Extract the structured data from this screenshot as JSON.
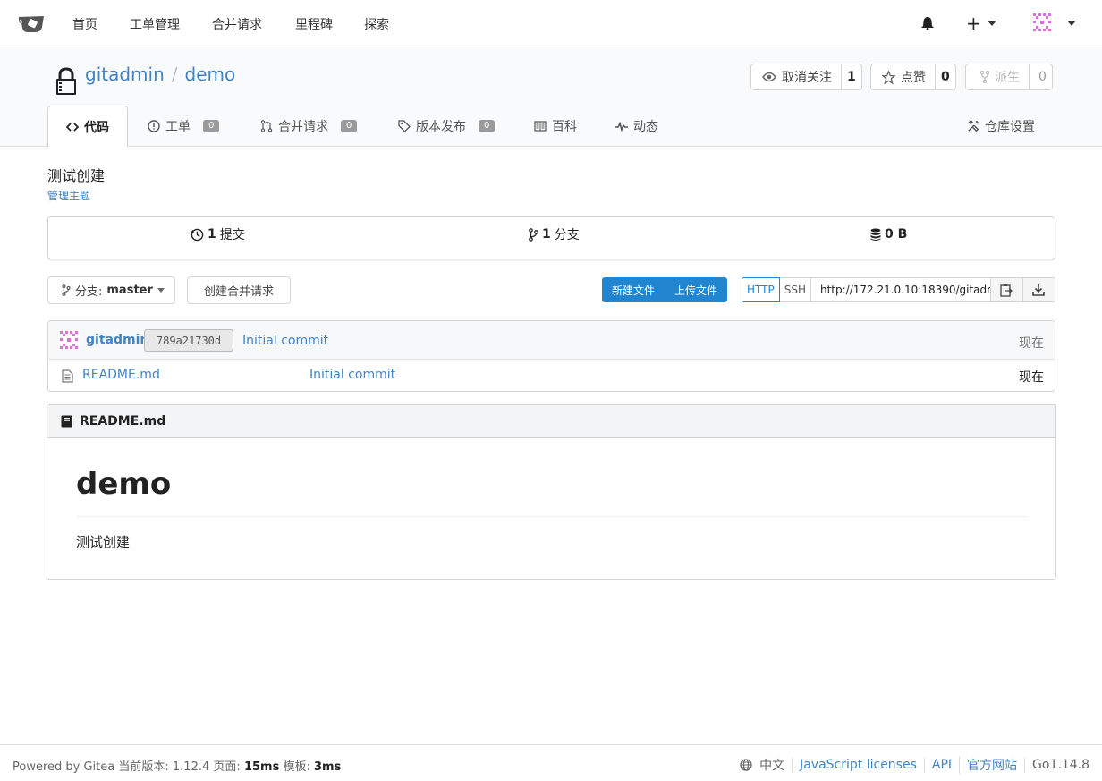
{
  "nav": {
    "items": [
      "首页",
      "工单管理",
      "合并请求",
      "里程碑",
      "探索"
    ]
  },
  "repo": {
    "owner": "gitadmin",
    "separator": "/",
    "name": "demo",
    "watch": {
      "label": "取消关注",
      "count": "1"
    },
    "star": {
      "label": "点赞",
      "count": "0"
    },
    "fork": {
      "label": "派生",
      "count": "0"
    }
  },
  "tabs": [
    {
      "label": "代码"
    },
    {
      "label": "工单",
      "badge": "0"
    },
    {
      "label": "合并请求",
      "badge": "0"
    },
    {
      "label": "版本发布",
      "badge": "0"
    },
    {
      "label": "百科"
    },
    {
      "label": "动态"
    }
  ],
  "settings_label": "仓库设置",
  "description": "测试创建",
  "manage_topics": "管理主题",
  "stats": {
    "commits_num": "1",
    "commits_label": "提交",
    "branches_num": "1",
    "branches_label": "分支",
    "size": "0 B"
  },
  "branch": {
    "label": "分支:",
    "name": "master"
  },
  "create_pr": "创建合并请求",
  "file_buttons": {
    "new_file": "新建文件",
    "upload_file": "上传文件"
  },
  "clone": {
    "http": "HTTP",
    "ssh": "SSH",
    "url": "http://172.21.0.10:18390/gitadmi"
  },
  "latest_commit": {
    "author": "gitadmin",
    "sha": "789a21730d",
    "message": "Initial commit",
    "time": "现在"
  },
  "files": [
    {
      "name": "README.md",
      "message": "Initial commit",
      "time": "现在"
    }
  ],
  "readme": {
    "title": "README.md",
    "h1": "demo",
    "body": "测试创建"
  },
  "footer": {
    "powered": "Powered by Gitea",
    "version_label": "当前版本:",
    "version": "1.12.4",
    "page_label": "页面:",
    "page_time": "15ms",
    "template_label": "模板:",
    "template_time": "3ms",
    "lang": "中文",
    "js_licenses": "JavaScript licenses",
    "api": "API",
    "official": "官方网站",
    "go_version": "Go1.14.8"
  },
  "colors": {
    "accent": "#4183c4",
    "primary_button": "#2185d0",
    "badge": "#9a9a9a"
  }
}
